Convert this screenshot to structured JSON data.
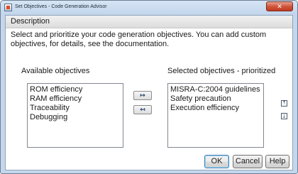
{
  "window": {
    "title": "Set Objectives - Code Generation Advisor",
    "close_glyph": "✕"
  },
  "description": {
    "heading": "Description",
    "text": "Select and prioritize your code generation objectives. You can add custom objectives, for details, see the documentation."
  },
  "available": {
    "label": "Available objectives",
    "items": [
      "ROM efficiency",
      "RAM efficiency",
      "Traceability",
      "Debugging"
    ]
  },
  "selected": {
    "label": "Selected objectives - prioritized",
    "items": [
      "MISRA-C:2004 guidelines",
      "Safety precaution",
      "Execution efficiency"
    ]
  },
  "transfer": {
    "add_glyph": "↦",
    "remove_glyph": "↤"
  },
  "priority": {
    "up_glyph": "⤒",
    "down_glyph": "⤓"
  },
  "buttons": {
    "ok": "OK",
    "cancel": "Cancel",
    "help": "Help"
  },
  "colors": {
    "frame": "#c4d7ec",
    "close": "#c03a20"
  }
}
